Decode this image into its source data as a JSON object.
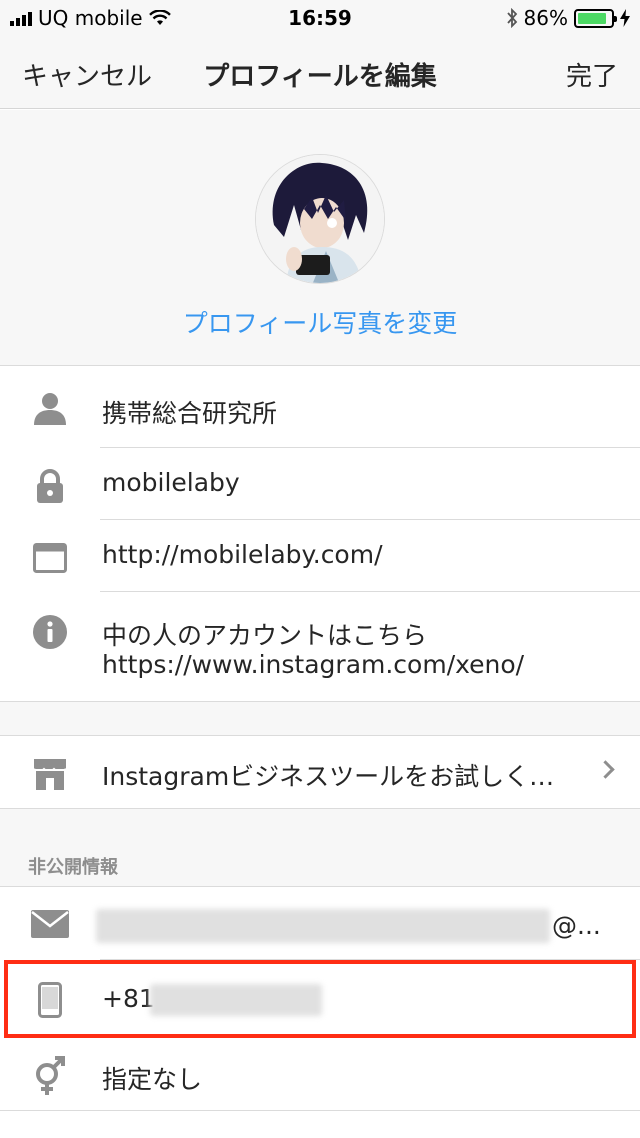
{
  "status_bar": {
    "carrier": "UQ mobile",
    "time": "16:59",
    "battery_percent": "86%",
    "battery_level": 0.86,
    "battery_color": "#4cd964",
    "icons": [
      "signal-icon",
      "wifi-icon",
      "bluetooth-icon",
      "battery-icon",
      "charging-bolt-icon"
    ]
  },
  "nav": {
    "cancel_label": "キャンセル",
    "title": "プロフィールを編集",
    "done_label": "完了"
  },
  "profile": {
    "avatar_icon": "avatar-photo",
    "change_photo_label": "プロフィール写真を変更"
  },
  "fields": [
    {
      "icon": "person-icon",
      "value": "携帯総合研究所"
    },
    {
      "icon": "lock-icon",
      "value": "mobilelaby"
    },
    {
      "icon": "browser-icon",
      "value": "http://mobilelaby.com/"
    },
    {
      "icon": "info-icon",
      "value_line1": "中の人のアカウントはこちら",
      "value_line2": "https://www.instagram.com/xeno/"
    }
  ],
  "business": {
    "icon": "shop-icon",
    "label": "Instagramビジネスツールをお試しく…"
  },
  "private": {
    "section_title": "非公開情報",
    "email_icon": "mail-icon",
    "email_suffix": "@...",
    "phone_icon": "phone-icon",
    "phone_prefix": "+81",
    "gender_icon": "gender-icon",
    "gender_value": "指定なし"
  },
  "colors": {
    "link": "#3897f0",
    "text": "#262626",
    "icon": "#8e8e8e",
    "highlight": "#ff2d14",
    "background": "#f7f7f7"
  }
}
